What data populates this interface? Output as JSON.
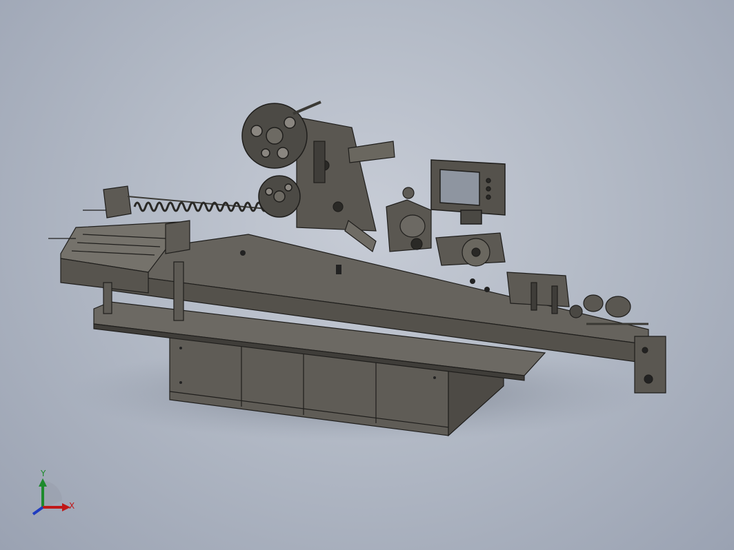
{
  "triad": {
    "x_label": "X",
    "y_label": "Y"
  },
  "colors": {
    "background_center": "#c7ccd6",
    "background_edge": "#9aa2b2",
    "body": "#595650",
    "body_light": "#7a766f",
    "edge": "#1f1e1c",
    "screen": "#8e95a0",
    "axis_x": "#c01818",
    "axis_y": "#1d8a2c",
    "axis_z": "#1f3cc0"
  }
}
